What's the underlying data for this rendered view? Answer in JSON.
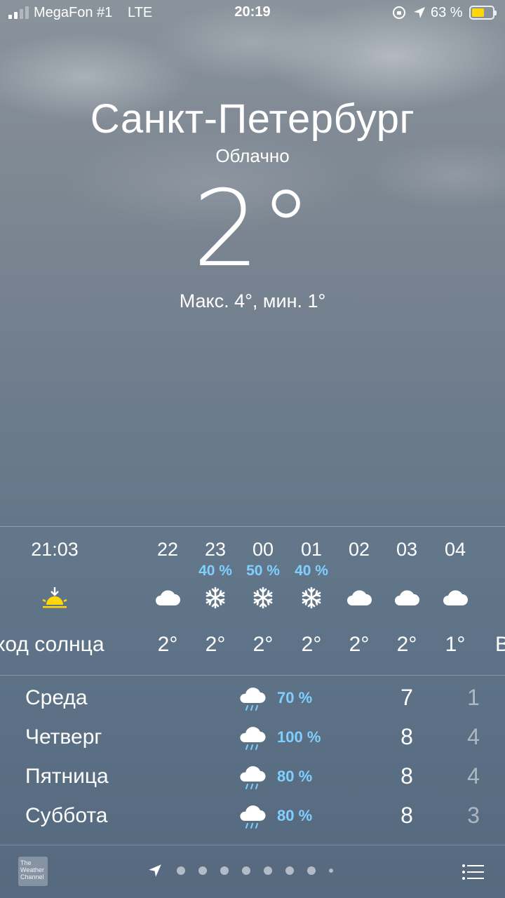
{
  "status_bar": {
    "carrier": "MegaFon #1",
    "network": "LTE",
    "time": "20:19",
    "battery_percent": "63 %",
    "icons": [
      "signal-icon",
      "orientation-lock-icon",
      "location-arrow-icon",
      "battery-icon"
    ]
  },
  "current": {
    "city": "Санкт-Петербург",
    "condition": "Облачно",
    "temperature": "2°",
    "min_max": "Макс. 4°, мин. 1°"
  },
  "hourly": [
    {
      "time": "21:03",
      "precip": "",
      "icon": "sunset-icon",
      "temp": "аход солнца"
    },
    {
      "time": "22",
      "precip": "",
      "icon": "cloud-icon",
      "temp": "2°"
    },
    {
      "time": "23",
      "precip": "40 %",
      "icon": "snowflake-icon",
      "temp": "2°"
    },
    {
      "time": "00",
      "precip": "50 %",
      "icon": "snowflake-icon",
      "temp": "2°"
    },
    {
      "time": "01",
      "precip": "40 %",
      "icon": "snowflake-icon",
      "temp": "2°"
    },
    {
      "time": "02",
      "precip": "",
      "icon": "cloud-icon",
      "temp": "2°"
    },
    {
      "time": "03",
      "precip": "",
      "icon": "cloud-icon",
      "temp": "2°"
    },
    {
      "time": "04",
      "precip": "",
      "icon": "cloud-icon",
      "temp": "1°"
    },
    {
      "time": "",
      "precip": "",
      "icon": "",
      "temp": "В"
    }
  ],
  "daily": [
    {
      "day": "Среда",
      "icon": "rain-cloud-icon",
      "precip": "70 %",
      "max": "7",
      "min": "1"
    },
    {
      "day": "Четверг",
      "icon": "rain-cloud-icon",
      "precip": "100 %",
      "max": "8",
      "min": "4"
    },
    {
      "day": "Пятница",
      "icon": "rain-cloud-icon",
      "precip": "80 %",
      "max": "8",
      "min": "4"
    },
    {
      "day": "Суббота",
      "icon": "rain-cloud-icon",
      "precip": "80 %",
      "max": "8",
      "min": "3"
    }
  ],
  "toolbar": {
    "logo_text": "The Weather Channel",
    "page_dots": 9
  },
  "colors": {
    "precip_text": "#7fd0ff",
    "sun": "#ffd60a",
    "battery_fill": "#ffd60a"
  }
}
